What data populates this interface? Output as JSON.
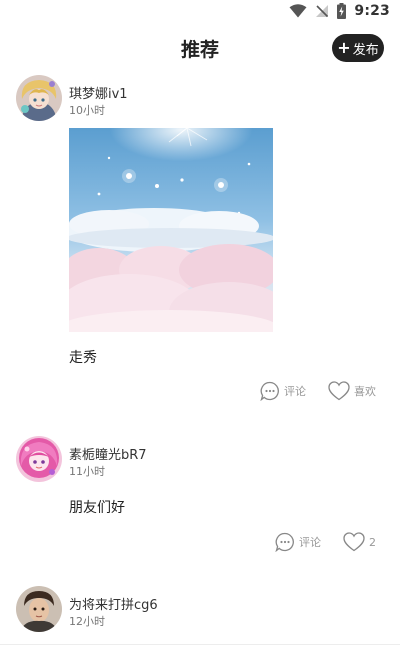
{
  "status_bar": {
    "time": "9:23",
    "icons": [
      "wifi-icon",
      "no-signal-icon",
      "battery-charging-icon"
    ]
  },
  "header": {
    "title": "推荐",
    "publish_label": "发布",
    "publish_icon": "plus-icon"
  },
  "posts": [
    {
      "username": "琪梦娜iv1",
      "time": "10小时",
      "text": "走秀",
      "has_image": true,
      "image_description_icon": "sky-clouds-image",
      "comment_label": "评论",
      "like_label": "喜欢"
    },
    {
      "username": "素栀瞳光bR7",
      "time": "11小时",
      "text": "朋友们好",
      "has_image": false,
      "comment_label": "评论",
      "like_label": "2"
    },
    {
      "username": "为将来打拼cg6",
      "time": "12小时"
    }
  ],
  "colors": {
    "primary_text": "#222222",
    "secondary_text": "#777777",
    "action_text": "#999999",
    "publish_button_bg": "#222222"
  }
}
